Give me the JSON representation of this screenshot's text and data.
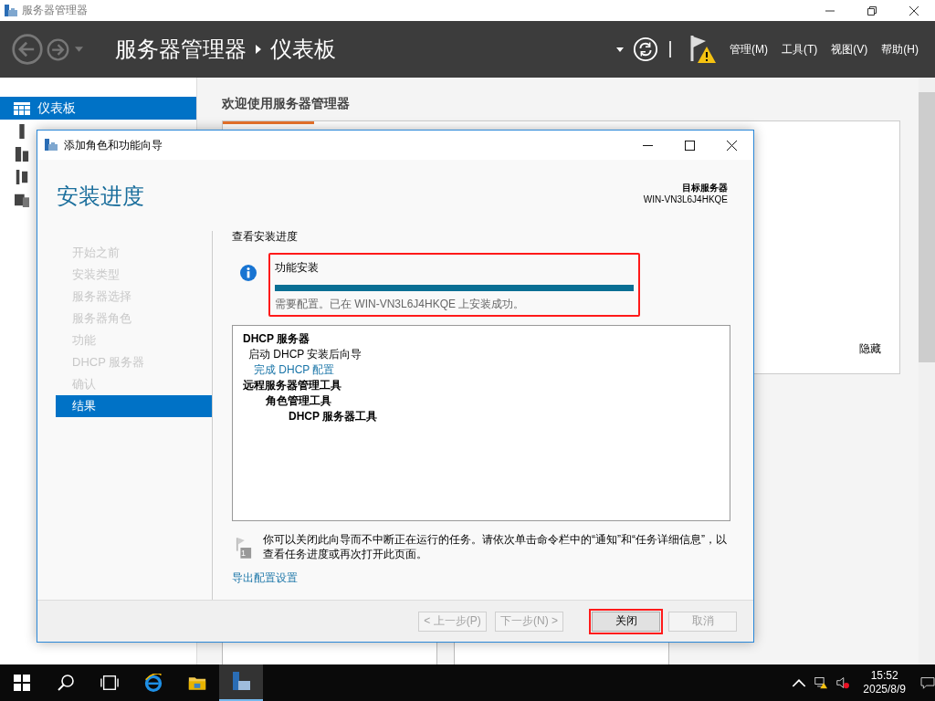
{
  "window": {
    "title": "服务器管理器"
  },
  "header": {
    "breadcrumb": [
      "服务器管理器",
      "仪表板"
    ],
    "menus": [
      "管理(M)",
      "工具(T)",
      "视图(V)",
      "帮助(H)"
    ]
  },
  "sidebar": {
    "items": [
      {
        "label": "仪表板",
        "selected": true
      },
      {
        "selected": false
      },
      {
        "selected": false
      },
      {
        "selected": false
      },
      {
        "selected": false
      }
    ]
  },
  "main": {
    "welcome_title": "欢迎使用服务器管理器",
    "hide_link": "隐藏"
  },
  "dialog": {
    "title": "添加角色和功能向导",
    "heading": "安装进度",
    "target_label": "目标服务器",
    "target_server": "WIN-VN3L6J4HKQE",
    "steps": [
      {
        "label": "开始之前",
        "selected": false
      },
      {
        "label": "安装类型",
        "selected": false
      },
      {
        "label": "服务器选择",
        "selected": false
      },
      {
        "label": "服务器角色",
        "selected": false
      },
      {
        "label": "功能",
        "selected": false
      },
      {
        "label": "DHCP 服务器",
        "selected": false
      },
      {
        "label": "确认",
        "selected": false
      },
      {
        "label": "结果",
        "selected": true
      }
    ],
    "section_title": "查看安装进度",
    "progress": {
      "title": "功能安装",
      "level": 1,
      "message": "需要配置。已在 WIN-VN3L6J4HKQE 上安装成功。",
      "highlighted": true
    },
    "results": [
      {
        "text": "DHCP 服务器",
        "kind": "bold",
        "children": [
          {
            "text": "启动 DHCP 安装后向导",
            "kind": "plain",
            "children": [
              {
                "text": "完成 DHCP 配置",
                "kind": "link"
              }
            ]
          }
        ]
      },
      {
        "text": "远程服务器管理工具",
        "kind": "bold",
        "children": [
          {
            "text": "角色管理工具",
            "kind": "bold",
            "children": [
              {
                "text": "DHCP 服务器工具",
                "kind": "bold"
              }
            ]
          }
        ]
      }
    ],
    "note": "你可以关闭此向导而不中断正在运行的任务。请依次单击命令栏中的“通知”和“任务详细信息”，以查看任务进度或再次打开此页面。",
    "note_badge": "1",
    "export_link": "导出配置设置",
    "buttons": [
      {
        "label": "< 上一步(P)",
        "disabled": true,
        "highlighted": false
      },
      {
        "label": "下一步(N) >",
        "disabled": true,
        "highlighted": false
      },
      {
        "label": "关闭",
        "disabled": false,
        "highlighted": true
      },
      {
        "label": "取消",
        "disabled": true,
        "highlighted": false
      }
    ]
  },
  "taskbar": {
    "time": "15:52",
    "date": "2025/8/9"
  }
}
